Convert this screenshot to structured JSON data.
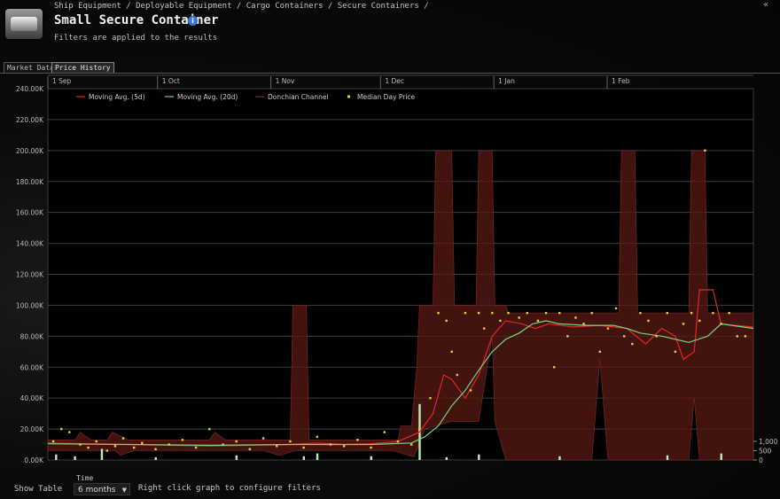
{
  "header": {
    "breadcrumb": "Ship Equipment / Deployable Equipment / Cargo Containers / Secure Containers /",
    "title": "Small Secure Container",
    "subtitle": "Filters are applied to the results",
    "info_icon": "info-icon",
    "close_icon": "collapse-icon"
  },
  "tabs": [
    {
      "label": "Market Data",
      "active": false
    },
    {
      "label": "Price History",
      "active": true
    }
  ],
  "footer": {
    "show_table": "Show Table",
    "time_label": "Time",
    "time_value": "6 months",
    "hint": "Right click graph to configure filters"
  },
  "colors": {
    "ma5": "#e02828",
    "ma20": "#7ad47a",
    "donchian": "#5a1a16",
    "median": "#e6d13a",
    "volume": "#b8f0b0"
  },
  "chart_data": {
    "type": "line",
    "x_ticks": [
      "1 Sep",
      "1 Oct",
      "1 Nov",
      "1 Dec",
      "1 Jan",
      "1 Feb"
    ],
    "y_ticks": [
      "0.00K",
      "20.00K",
      "40.00K",
      "60.00K",
      "80.00K",
      "100.00K",
      "120.00K",
      "140.00K",
      "160.00K",
      "180.00K",
      "200.00K",
      "220.00K",
      "240.00K"
    ],
    "ylim": [
      0,
      240000
    ],
    "volume_ticks": [
      "0",
      "500",
      "1,000"
    ],
    "volume_lim": [
      0,
      3800
    ],
    "legend": [
      "Moving Avg. (5d)",
      "Moving Avg. (20d)",
      "Donchian Channel",
      "Median Day Price"
    ],
    "x_range": [
      "1 Sep",
      "12 Mar"
    ],
    "series": [
      {
        "name": "Moving Avg. (5d)",
        "points": [
          [
            0,
            11000
          ],
          [
            15,
            10500
          ],
          [
            30,
            10000
          ],
          [
            45,
            9500
          ],
          [
            60,
            9000
          ],
          [
            75,
            9500
          ],
          [
            90,
            10000
          ],
          [
            100,
            11000
          ],
          [
            110,
            10000
          ],
          [
            120,
            10500
          ],
          [
            130,
            12000
          ],
          [
            138,
            18000
          ],
          [
            143,
            30000
          ],
          [
            147,
            55000
          ],
          [
            150,
            52000
          ],
          [
            155,
            40000
          ],
          [
            160,
            55000
          ],
          [
            165,
            80000
          ],
          [
            170,
            90000
          ],
          [
            176,
            88000
          ],
          [
            181,
            85000
          ],
          [
            186,
            88000
          ],
          [
            195,
            86000
          ],
          [
            205,
            87000
          ],
          [
            215,
            85000
          ],
          [
            222,
            75000
          ],
          [
            228,
            85000
          ],
          [
            233,
            80000
          ],
          [
            236,
            65000
          ],
          [
            240,
            70000
          ],
          [
            242,
            110000
          ],
          [
            247,
            110000
          ],
          [
            250,
            88000
          ],
          [
            255,
            87000
          ],
          [
            262,
            86000
          ]
        ]
      },
      {
        "name": "Moving Avg. (20d)",
        "points": [
          [
            0,
            10500
          ],
          [
            30,
            10000
          ],
          [
            60,
            9500
          ],
          [
            90,
            10000
          ],
          [
            120,
            10000
          ],
          [
            135,
            11000
          ],
          [
            140,
            15000
          ],
          [
            145,
            22000
          ],
          [
            150,
            35000
          ],
          [
            155,
            45000
          ],
          [
            160,
            58000
          ],
          [
            165,
            70000
          ],
          [
            170,
            78000
          ],
          [
            175,
            82000
          ],
          [
            180,
            88000
          ],
          [
            185,
            90000
          ],
          [
            190,
            88000
          ],
          [
            200,
            87000
          ],
          [
            210,
            87000
          ],
          [
            215,
            85000
          ],
          [
            220,
            82000
          ],
          [
            228,
            80000
          ],
          [
            233,
            78000
          ],
          [
            238,
            76000
          ],
          [
            245,
            80000
          ],
          [
            250,
            88000
          ],
          [
            262,
            85000
          ]
        ]
      }
    ],
    "donchian": {
      "upper": [
        [
          0,
          13000
        ],
        [
          10,
          13000
        ],
        [
          12,
          18000
        ],
        [
          16,
          13000
        ],
        [
          22,
          13000
        ],
        [
          24,
          18000
        ],
        [
          30,
          13000
        ],
        [
          60,
          13000
        ],
        [
          62,
          18000
        ],
        [
          66,
          13000
        ],
        [
          90,
          13000
        ],
        [
          91,
          100000
        ],
        [
          96,
          100000
        ],
        [
          97,
          13000
        ],
        [
          130,
          13000
        ],
        [
          131,
          22000
        ],
        [
          135,
          22000
        ],
        [
          137,
          60000
        ],
        [
          138,
          100000
        ],
        [
          143,
          100000
        ],
        [
          144,
          200000
        ],
        [
          150,
          200000
        ],
        [
          151,
          100000
        ],
        [
          159,
          100000
        ],
        [
          160,
          200000
        ],
        [
          165,
          200000
        ],
        [
          166,
          100000
        ],
        [
          170,
          100000
        ],
        [
          171,
          95000
        ],
        [
          212,
          95000
        ],
        [
          213,
          200000
        ],
        [
          218,
          200000
        ],
        [
          219,
          95000
        ],
        [
          238,
          95000
        ],
        [
          239,
          200000
        ],
        [
          244,
          200000
        ],
        [
          245,
          95000
        ],
        [
          262,
          95000
        ]
      ],
      "lower": [
        [
          0,
          6000
        ],
        [
          25,
          6000
        ],
        [
          27,
          3000
        ],
        [
          32,
          6000
        ],
        [
          80,
          6000
        ],
        [
          86,
          3000
        ],
        [
          92,
          6000
        ],
        [
          128,
          6000
        ],
        [
          136,
          2000
        ],
        [
          140,
          20000
        ],
        [
          150,
          25000
        ],
        [
          160,
          25000
        ],
        [
          165,
          80000
        ],
        [
          166,
          25000
        ],
        [
          170,
          0
        ],
        [
          202,
          0
        ],
        [
          205,
          65000
        ],
        [
          208,
          0
        ],
        [
          238,
          0
        ],
        [
          240,
          40000
        ],
        [
          242,
          0
        ],
        [
          262,
          0
        ]
      ]
    },
    "median_points": [
      [
        2,
        12000
      ],
      [
        5,
        20000
      ],
      [
        8,
        18000
      ],
      [
        12,
        10000
      ],
      [
        15,
        8000
      ],
      [
        18,
        12000
      ],
      [
        22,
        6000
      ],
      [
        25,
        9000
      ],
      [
        28,
        14000
      ],
      [
        32,
        8000
      ],
      [
        35,
        11000
      ],
      [
        40,
        7000
      ],
      [
        45,
        10000
      ],
      [
        50,
        13000
      ],
      [
        55,
        8000
      ],
      [
        60,
        20000
      ],
      [
        65,
        10000
      ],
      [
        70,
        12000
      ],
      [
        75,
        7000
      ],
      [
        80,
        14000
      ],
      [
        85,
        9000
      ],
      [
        90,
        12000
      ],
      [
        95,
        8000
      ],
      [
        100,
        15000
      ],
      [
        105,
        10000
      ],
      [
        110,
        9000
      ],
      [
        115,
        13000
      ],
      [
        120,
        8000
      ],
      [
        125,
        18000
      ],
      [
        130,
        12000
      ],
      [
        135,
        10000
      ],
      [
        138,
        20000
      ],
      [
        142,
        40000
      ],
      [
        145,
        95000
      ],
      [
        148,
        90000
      ],
      [
        150,
        70000
      ],
      [
        152,
        55000
      ],
      [
        155,
        95000
      ],
      [
        157,
        45000
      ],
      [
        160,
        95000
      ],
      [
        162,
        85000
      ],
      [
        165,
        95000
      ],
      [
        168,
        90000
      ],
      [
        171,
        95000
      ],
      [
        175,
        92000
      ],
      [
        178,
        95000
      ],
      [
        182,
        90000
      ],
      [
        185,
        95000
      ],
      [
        188,
        60000
      ],
      [
        190,
        95000
      ],
      [
        193,
        80000
      ],
      [
        196,
        92000
      ],
      [
        199,
        88000
      ],
      [
        202,
        95000
      ],
      [
        205,
        70000
      ],
      [
        208,
        85000
      ],
      [
        211,
        98000
      ],
      [
        214,
        80000
      ],
      [
        217,
        75000
      ],
      [
        220,
        95000
      ],
      [
        223,
        90000
      ],
      [
        226,
        80000
      ],
      [
        230,
        95000
      ],
      [
        233,
        70000
      ],
      [
        236,
        88000
      ],
      [
        239,
        95000
      ],
      [
        242,
        90000
      ],
      [
        244,
        200000
      ],
      [
        247,
        95000
      ],
      [
        250,
        88000
      ],
      [
        253,
        95000
      ],
      [
        256,
        80000
      ],
      [
        259,
        80000
      ]
    ],
    "volume_bars": [
      [
        3,
        300
      ],
      [
        10,
        200
      ],
      [
        20,
        600
      ],
      [
        40,
        150
      ],
      [
        70,
        250
      ],
      [
        95,
        200
      ],
      [
        100,
        350
      ],
      [
        120,
        200
      ],
      [
        138,
        3000
      ],
      [
        148,
        150
      ],
      [
        160,
        300
      ],
      [
        190,
        200
      ],
      [
        230,
        250
      ],
      [
        250,
        350
      ]
    ]
  }
}
